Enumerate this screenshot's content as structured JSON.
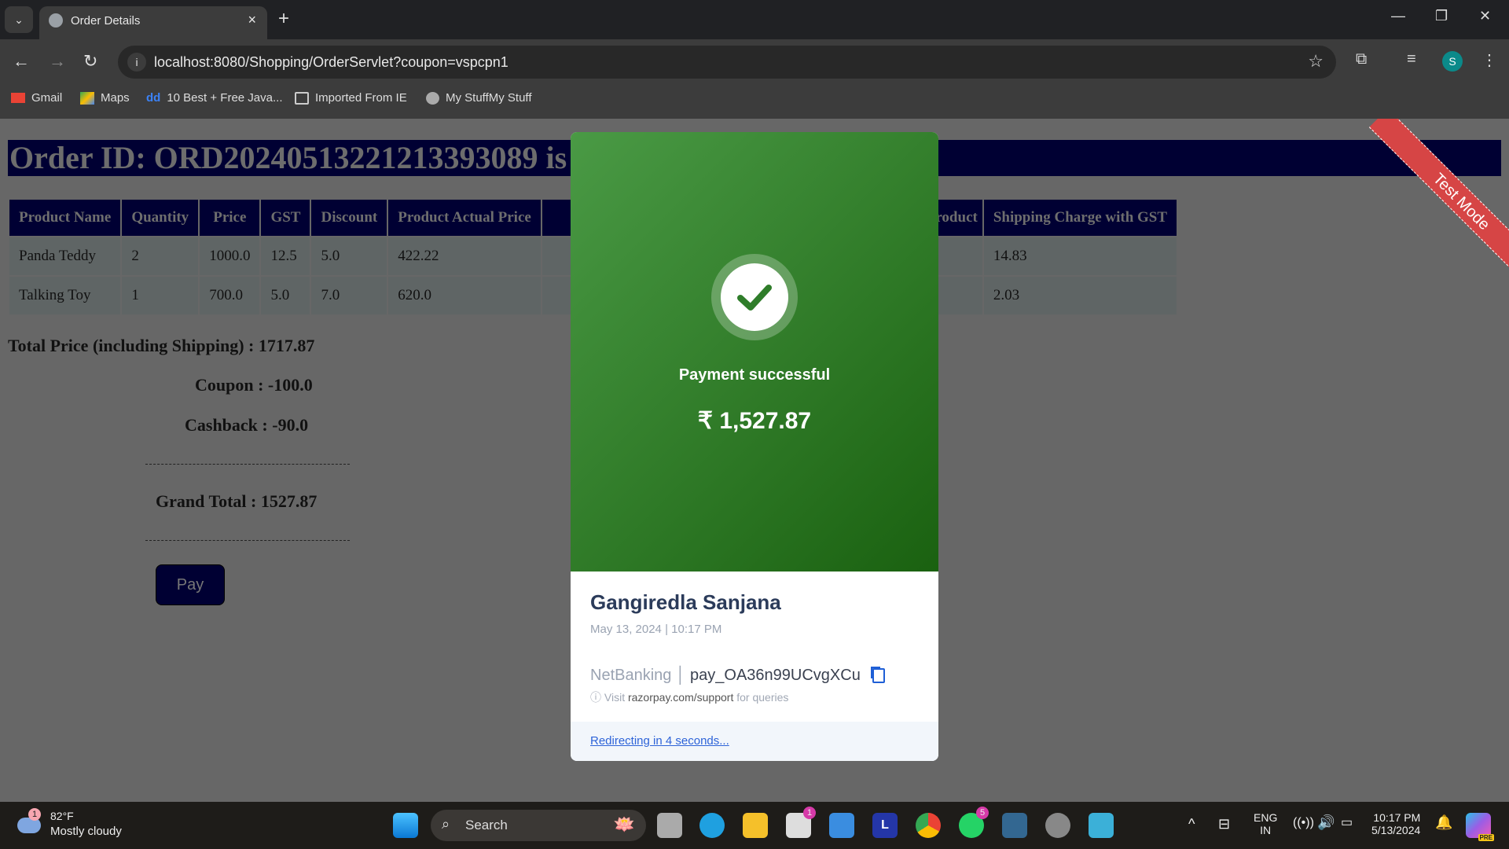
{
  "browser": {
    "tab_title": "Order Details",
    "url": "localhost:8080/Shopping/OrderServlet?coupon=vspcpn1",
    "bookmarks": [
      "Gmail",
      "Maps",
      "10 Best + Free Java...",
      "Imported From IE",
      "My StuffMy Stuff"
    ],
    "profile_initial": "S"
  },
  "page": {
    "banner": "Order ID: ORD20240513221213393089 is",
    "columns": [
      "Product Name",
      "Quantity",
      "Price",
      "GST",
      "Discount",
      "Product Actual Price",
      "Product",
      "Shipping Charge with GST"
    ],
    "rows": [
      [
        "Panda Teddy",
        "2",
        "1000.0",
        "12.5",
        "5.0",
        "422.22",
        "",
        "14.83"
      ],
      [
        "Talking Toy",
        "1",
        "700.0",
        "5.0",
        "7.0",
        "620.0",
        "",
        "2.03"
      ]
    ],
    "total": "Total Price (including Shipping) : 1717.87",
    "coupon": "Coupon : -100.0",
    "cashback": "Cashback : -90.0",
    "grand_total": "Grand Total : 1527.87",
    "pay_label": "Pay"
  },
  "ribbon": "Test Mode",
  "modal": {
    "status": "Payment successful",
    "amount": "₹ 1,527.87",
    "name": "Gangiredla Sanjana",
    "date": "May 13, 2024",
    "time": "10:17 PM",
    "method": "NetBanking",
    "payment_id": "pay_OA36n99UCvgXCu",
    "visit_pre": "Visit",
    "visit_link": "razorpay.com/support",
    "visit_post": "for queries",
    "redirect": "Redirecting in 4 seconds..."
  },
  "taskbar": {
    "temp": "82°F",
    "weather": "Mostly cloudy",
    "weather_badge": "1",
    "search": "Search",
    "store_badge": "1",
    "whatsapp_badge": "5",
    "lang1": "ENG",
    "lang2": "IN",
    "time": "10:17 PM",
    "date": "5/13/2024",
    "copilot_badge": "PRE"
  }
}
